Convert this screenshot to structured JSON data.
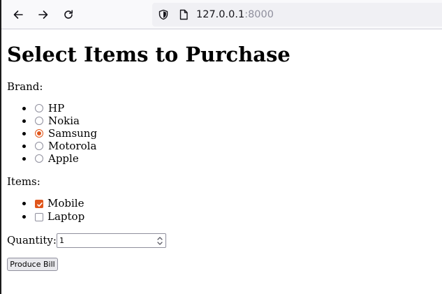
{
  "browser": {
    "url_host": "127.0.0.1",
    "url_port": ":8000",
    "icons": {
      "back": "arrow-left-icon",
      "forward": "arrow-right-icon",
      "reload": "reload-icon",
      "security": "shield-icon",
      "page": "page-icon"
    }
  },
  "page": {
    "title": "Select Items to Purchase",
    "brand_label": "Brand:",
    "brands": [
      {
        "label": "HP",
        "checked": false
      },
      {
        "label": "Nokia",
        "checked": false
      },
      {
        "label": "Samsung",
        "checked": true
      },
      {
        "label": "Motorola",
        "checked": false
      },
      {
        "label": "Apple",
        "checked": false
      }
    ],
    "items_label": "Items:",
    "items": [
      {
        "label": "Mobile",
        "checked": true
      },
      {
        "label": "Laptop",
        "checked": false
      }
    ],
    "quantity_label": "Quantity:",
    "quantity_value": "1",
    "submit_label": "Produce Bill"
  },
  "colors": {
    "accent": "#e0561b",
    "toolbar_bg": "#f9f9fb",
    "urlbar_bg": "#f0f0f4"
  }
}
